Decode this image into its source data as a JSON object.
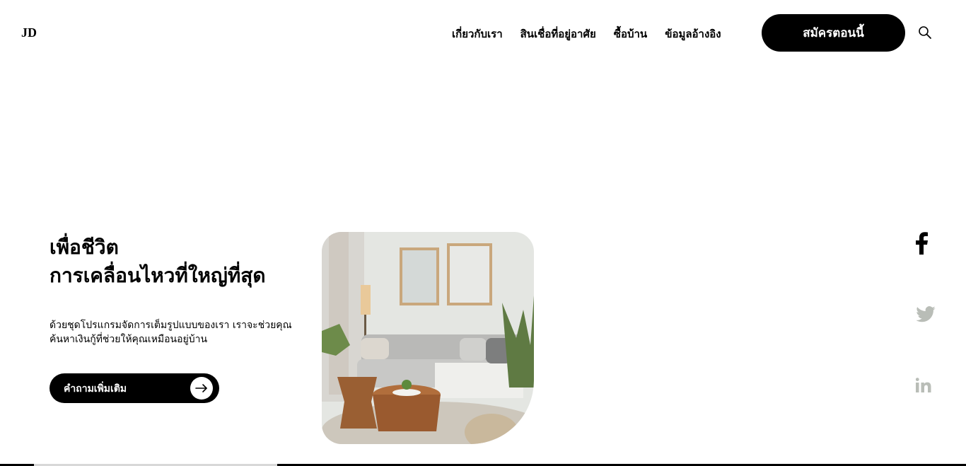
{
  "header": {
    "logo": "JD",
    "nav": [
      "เกี่ยวกับเรา",
      "สินเชื่อที่อยู่อาศัย",
      "ซื้อบ้าน",
      "ข้อมูลอ้างอิง"
    ],
    "cta_label": "สมัครตอนนี้",
    "search_icon": "search-icon"
  },
  "hero": {
    "title_line1": "เพื่อชีวิต",
    "title_line2": "การเคลื่อนไหวที่ใหญ่ที่สุด",
    "desc_line1": "ด้วยชุดโปรแกรมจัดการเต็มรูปแบบของเรา เราจะช่วยคุณ",
    "desc_line2": "ค้นหาเงินกู้ที่ช่วยให้คุณเหมือนอยู่บ้าน",
    "button_label": "คำถามเพิ่มเติม",
    "button_icon": "arrow-right-icon",
    "image": "living-room-photo"
  },
  "social": {
    "icons": [
      "facebook-icon",
      "twitter-icon",
      "linkedin-icon"
    ],
    "colors": {
      "active": "#000000",
      "inactive": "#b9bdb7"
    }
  },
  "colors": {
    "accent": "#000000",
    "background": "#ffffff"
  }
}
